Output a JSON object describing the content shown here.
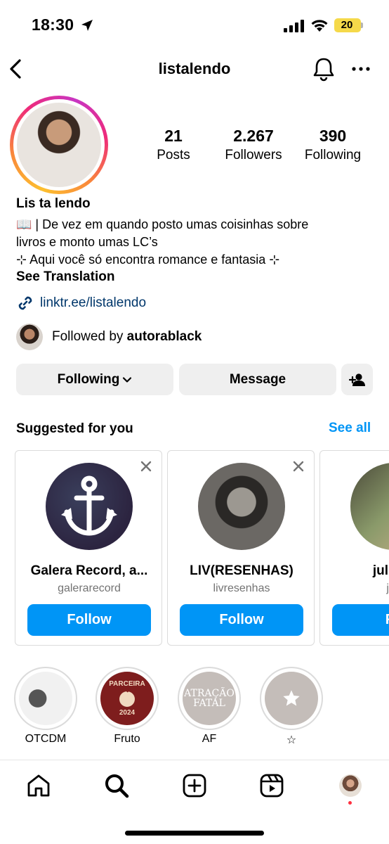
{
  "status_bar": {
    "time": "18:30",
    "battery": "20",
    "battery_color": "#f5d94a"
  },
  "header": {
    "username": "listalendo"
  },
  "profile": {
    "stats": [
      {
        "value": "21",
        "label": "Posts"
      },
      {
        "value": "2.267",
        "label": "Followers"
      },
      {
        "value": "390",
        "label": "Following"
      }
    ],
    "display_name": "Lis ta lendo",
    "bio_lines": [
      "📖 | De vez em quando posto umas coisinhas sobre",
      "livros e monto umas LC’s",
      "⊹ Aqui você só encontra romance e fantasia ⊹"
    ],
    "see_translation": "See Translation",
    "link": "linktr.ee/listalendo",
    "followed_by_prefix": "Followed by ",
    "followed_by_user": "autorablack"
  },
  "actions": {
    "following": "Following",
    "message": "Message"
  },
  "suggested": {
    "title": "Suggested for you",
    "see_all": "See all",
    "cards": [
      {
        "name": "Galera Record, a...",
        "handle": "galerarecord",
        "follow": "Follow"
      },
      {
        "name": "LIV(RESENHAS)",
        "handle": "livresenhas",
        "follow": "Follow"
      },
      {
        "name": "julia m",
        "handle": "jbo",
        "follow": "Fo"
      }
    ]
  },
  "highlights": [
    {
      "label": "OTCDM"
    },
    {
      "label": "Fruto",
      "art_top": "PARCEIRA",
      "art_bottom": "2024"
    },
    {
      "label": "AF",
      "art_text": "ATRAÇÃO FATAL"
    },
    {
      "label": "☆"
    }
  ],
  "colors": {
    "accent_blue": "#0095f6",
    "link_blue": "#00376b",
    "button_gray": "#efefef"
  }
}
